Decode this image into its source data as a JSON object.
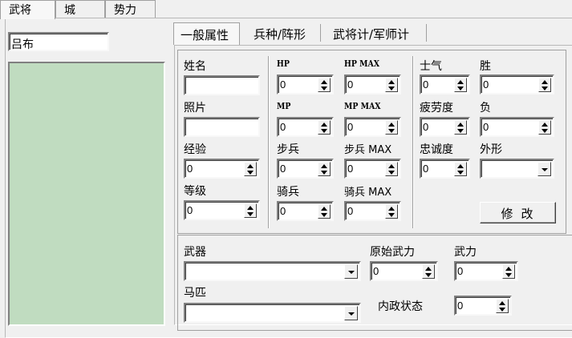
{
  "top_tabs": [
    "武将",
    "城",
    "势力"
  ],
  "general_name": "吕布",
  "inner_tabs": [
    "一般属性",
    "兵种/阵形",
    "武将计/军师计"
  ],
  "fields": {
    "name": {
      "label": "姓名",
      "value": ""
    },
    "photo": {
      "label": "照片",
      "value": ""
    },
    "exp": {
      "label": "经验",
      "value": "0"
    },
    "level": {
      "label": "等级",
      "value": "0"
    },
    "hp": {
      "label": "HP",
      "value": "0"
    },
    "hp_max": {
      "label": "HP MAX",
      "value": "0"
    },
    "mp": {
      "label": "MP",
      "value": "0"
    },
    "mp_max": {
      "label": "MP MAX",
      "value": "0"
    },
    "infantry": {
      "label": "步兵",
      "value": "0"
    },
    "infantry_max": {
      "label": "步兵 MAX",
      "value": "0"
    },
    "cavalry": {
      "label": "骑兵",
      "value": "0"
    },
    "cavalry_max": {
      "label": "骑兵 MAX",
      "value": "0"
    },
    "morale": {
      "label": "士气",
      "value": "0"
    },
    "wins": {
      "label": "胜",
      "value": "0"
    },
    "fatigue": {
      "label": "疲劳度",
      "value": "0"
    },
    "losses": {
      "label": "负",
      "value": "0"
    },
    "loyalty": {
      "label": "忠诚度",
      "value": "0"
    },
    "appearance": {
      "label": "外形",
      "value": ""
    },
    "weapon": {
      "label": "武器",
      "value": ""
    },
    "base_force": {
      "label": "原始武力",
      "value": "0"
    },
    "force": {
      "label": "武力",
      "value": "0"
    },
    "horse": {
      "label": "马匹",
      "value": ""
    },
    "domestic": {
      "label": "内政状态",
      "value": "0"
    }
  },
  "modify_button": "修改"
}
